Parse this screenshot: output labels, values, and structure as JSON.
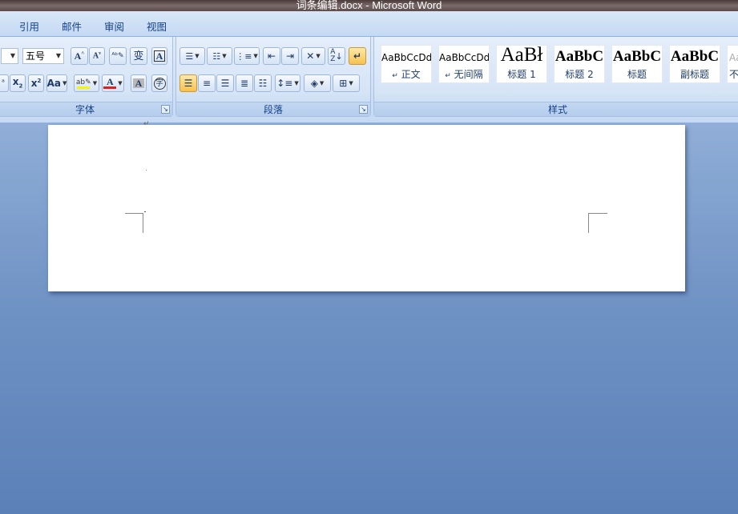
{
  "window": {
    "title": "词条编辑.docx - Microsoft Word"
  },
  "tabs": [
    {
      "label": "引用"
    },
    {
      "label": "邮件"
    },
    {
      "label": "审阅"
    },
    {
      "label": "视图"
    }
  ],
  "font_group": {
    "label": "字体",
    "font_size_value": "五号",
    "icons": [
      "grow-font-icon",
      "shrink-font-icon",
      "clear-formatting-icon",
      "phonetic-guide-icon",
      "character-border-icon",
      "strikethrough-icon",
      "subscript-icon",
      "superscript-icon",
      "change-case-icon",
      "text-highlight-icon",
      "font-color-icon",
      "character-shading-icon",
      "enclosed-character-icon"
    ]
  },
  "paragraph_group": {
    "label": "段落",
    "icons": [
      "bullets-icon",
      "numbering-icon",
      "multilevel-list-icon",
      "decrease-indent-icon",
      "increase-indent-icon",
      "chinese-layout-icon",
      "sort-icon",
      "show-marks-icon",
      "align-left-icon",
      "center-icon",
      "align-right-icon",
      "justify-icon",
      "distributed-icon",
      "line-spacing-icon",
      "shading-icon",
      "borders-icon"
    ]
  },
  "styles_group": {
    "label": "样式",
    "styles": [
      {
        "sample": "AaBbCcDd",
        "name": "正文",
        "mark": "↵"
      },
      {
        "sample": "AaBbCcDd",
        "name": "无间隔",
        "mark": "↵"
      },
      {
        "sample": "AaBł",
        "name": "标题 1",
        "mark": ""
      },
      {
        "sample": "AaBbC",
        "name": "标题 2",
        "mark": ""
      },
      {
        "sample": "AaBbC",
        "name": "标题",
        "mark": ""
      },
      {
        "sample": "AaBbC",
        "name": "副标题",
        "mark": ""
      },
      {
        "sample": "Aa",
        "name": "不",
        "mark": ""
      }
    ]
  },
  "document": {
    "paragraph_mark": "↵"
  },
  "colors": {
    "ribbon_bg": "#d3e2f6",
    "workspace_bg": "#6f92c4",
    "active_button": "#fbd67a",
    "font_color_bar": "#e0201b",
    "highlight_bar": "#f5f500"
  }
}
